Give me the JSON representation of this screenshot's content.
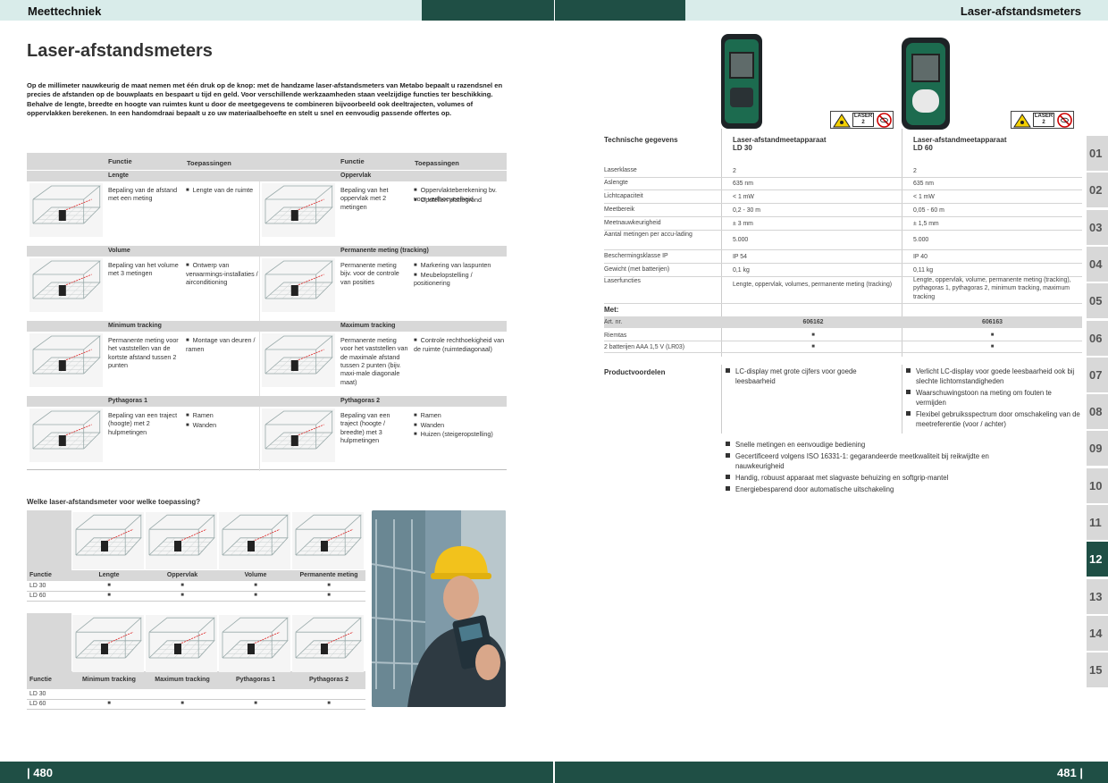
{
  "header": {
    "left_title": "Meettechniek",
    "right_title": "Laser-afstandsmeters"
  },
  "footer": {
    "left_page": "| 480",
    "right_page": "481 |"
  },
  "page_title": "Laser-afstandsmeters",
  "intro": "Op de millimeter nauwkeurig de maat nemen met één druk op de knop: met de handzame laser-afstandsmeters van Metabo bepaalt u razendsnel en precies de afstanden op de bouwplaats en bespaart u tijd en geld. Voor verschillende werkzaamheden staan veelzijdige functies ter beschikking. Behalve de lengte, breedte en hoogte van ruimtes kunt u door de meetgegevens te combineren bijvoorbeeld ook deeltrajecten, volumes of oppervlakken berekenen. In een handomdraai bepaalt u zo uw materiaalbehoefte en stelt u snel en eenvoudig passende offertes op.",
  "func_table": {
    "col_function": "Functie",
    "col_applications": "Toepassingen",
    "rows": [
      {
        "left": {
          "name": "Lengte",
          "desc": "Bepaling van de afstand met een meting",
          "apps": [
            "Lengte van de ruimte"
          ]
        },
        "right": {
          "name": "Oppervlak",
          "desc": "Bepaling van het oppervlak met 2 metingen",
          "apps": [
            "Oppervlakteberekening bv. voor verfhoeveelheid",
            "Opstellen plattegrond"
          ]
        }
      },
      {
        "left": {
          "name": "Volume",
          "desc": "Bepaling van het volume met 3 metingen",
          "apps": [
            "Ontwerp van verwarmings-installaties / airconditioning"
          ]
        },
        "right": {
          "name": "Permanente meting (tracking)",
          "desc": "Permanente meting bijv. voor de controle van posities",
          "apps": [
            "Markering van laspunten",
            "Meubelopstelling / positionering"
          ]
        }
      },
      {
        "left": {
          "name": "Minimum tracking",
          "desc": "Permanente meting voor het vaststellen van de kortste afstand tussen 2 punten",
          "apps": [
            "Montage van deuren / ramen"
          ]
        },
        "right": {
          "name": "Maximum tracking",
          "desc": "Permanente meting voor het vaststellen van de maximale afstand tussen 2 punten (bijv. maxi-male diagonale maat)",
          "apps": [
            "Controle rechthoekigheid van de ruimte (ruimtediagonaal)"
          ]
        }
      },
      {
        "left": {
          "name": "Pythagoras 1",
          "desc": "Bepaling van een traject (hoogte) met 2 hulpmetingen",
          "apps": [
            "Ramen",
            "Wanden"
          ]
        },
        "right": {
          "name": "Pythagoras 2",
          "desc": "Bepaling van een traject (hoogte / breedte) met 3 hulpmetingen",
          "apps": [
            "Ramen",
            "Wanden",
            "Huizen (steigeropstelling)"
          ]
        }
      }
    ]
  },
  "which_title": "Welke laser-afstandsmeter voor welke toepassing?",
  "which_table1": {
    "head": "Functie",
    "cols": [
      "Lengte",
      "Oppervlak",
      "Volume",
      "Permanente meting"
    ],
    "rows": [
      {
        "label": "LD 30",
        "marks": [
          "■",
          "■",
          "■",
          "■"
        ]
      },
      {
        "label": "LD 60",
        "marks": [
          "■",
          "■",
          "■",
          "■"
        ]
      }
    ]
  },
  "which_table2": {
    "head": "Functie",
    "cols": [
      "Minimum tracking",
      "Maximum tracking",
      "Pythagoras 1",
      "Pythagoras 2"
    ],
    "rows": [
      {
        "label": "LD 30",
        "marks": [
          "",
          "",
          "",
          ""
        ]
      },
      {
        "label": "LD 60",
        "marks": [
          "■",
          "■",
          "■",
          "■"
        ]
      }
    ]
  },
  "laser_tag": {
    "line1": "LASER",
    "line2": "2"
  },
  "specs": {
    "title": "Technische gegevens",
    "products": [
      {
        "name": "Laser-afstandmeetapparaat",
        "model": "LD 30"
      },
      {
        "name": "Laser-afstandmeetapparaat",
        "model": "LD 60"
      }
    ],
    "rows": [
      {
        "label": "Laserklasse",
        "v1": "2",
        "v2": "2"
      },
      {
        "label": "Aslengte",
        "v1": "635 nm",
        "v2": "635 nm"
      },
      {
        "label": "Lichtcapaciteit",
        "v1": "< 1 mW",
        "v2": "< 1 mW"
      },
      {
        "label": "Meetbereik",
        "v1": "0,2 - 30 m",
        "v2": "0,05 - 60 m"
      },
      {
        "label": "Meetnauwkeurigheid",
        "v1": "± 3 mm",
        "v2": "± 1,5 mm"
      },
      {
        "label": "Aantal metingen per accu-lading",
        "v1": "5.000",
        "v2": "5.000"
      },
      {
        "label": "Beschermingsklasse IP",
        "v1": "IP 54",
        "v2": "IP 40"
      },
      {
        "label": "Gewicht (met batterijen)",
        "v1": "0,1 kg",
        "v2": "0,11 kg"
      },
      {
        "label": "Laserfuncties",
        "v1": "Lengte, oppervlak, volumes, permanente meting (tracking)",
        "v2": "Lengte, oppervlak, volume, permanente meting (tracking), pythagoras 1, pythagoras 2, minimum tracking, maximum tracking"
      }
    ],
    "met_title": "Met:",
    "art_label": "Art. nr.",
    "art1": "606162",
    "art2": "606163",
    "met_rows": [
      {
        "label": "Riemtas",
        "v1": "■",
        "v2": "■"
      },
      {
        "label": "2 batterijen AAA 1,5 V (LR03)",
        "v1": "■",
        "v2": "■"
      }
    ]
  },
  "benefits": {
    "title": "Productvoordelen",
    "ld30": [
      "LC-display met grote cijfers voor goede leesbaarheid"
    ],
    "ld60": [
      "Verlicht LC-display voor goede leesbaarheid ook bij slechte lichtomstandigheden",
      "Waarschuwingstoon na meting om fouten te vermijden",
      "Flexibel gebruiksspectrum door omschakeling van de meetreferentie (voor / achter)"
    ],
    "common": [
      "Snelle metingen en eenvoudige bediening",
      "Gecertificeerd volgens ISO 16331-1: gegarandeerde meetkwaliteit bij reikwijdte en nauwkeurigheid",
      "Handig, robuust apparaat met slagvaste behuizing en softgrip-mantel",
      "Energiebesparend door automatische uitschakeling"
    ]
  },
  "side_tabs": [
    "01",
    "02",
    "03",
    "04",
    "05",
    "06",
    "07",
    "08",
    "09",
    "10",
    "11",
    "12",
    "13",
    "14",
    "15"
  ],
  "active_tab": "12",
  "colors": {
    "brand_dark": "#1f4f45",
    "header_light": "#d9ecea",
    "grey": "#d8d8d8"
  }
}
